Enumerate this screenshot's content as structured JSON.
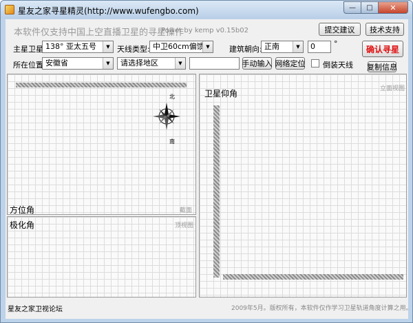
{
  "window": {
    "title": "星友之家寻星精灵(http://www.wufengbo.com)",
    "minimize_glyph": "—",
    "maximize_glyph": "□",
    "close_glyph": "✕"
  },
  "header": {
    "tagline": "本软件仅支持中国上空直播卫星的寻星操作",
    "power": "Power by kemp  v0.15b02",
    "feedback_button": "提交建议",
    "support_button": "技术支持"
  },
  "controls": {
    "satellite_label": "主星卫星:",
    "satellite_value": "138°   亚太五号",
    "antenna_label": "天线类型:",
    "antenna_value": "中卫60cm偏馈",
    "orientation_label": "建筑朝向:",
    "orientation_value": "正南",
    "orientation_degree": "0",
    "degree_symbol": "°",
    "confirm_button": "确认寻星",
    "location_label": "所在位置:",
    "province_value": "安徽省",
    "region_placeholder": "请选择地区",
    "manual_input_value": "",
    "manual_button": "手动输入",
    "network_button": "网络定位",
    "invert_label": "倒装天线",
    "copy_button": "复制信息"
  },
  "panels": {
    "azimuth": {
      "title": "方位角",
      "corner": "截面",
      "compass_north": "北",
      "compass_south": "南"
    },
    "polarization": {
      "title": "极化角",
      "corner": "顶视图"
    },
    "elevation": {
      "title": "卫星仰角",
      "corner": "立面视图"
    }
  },
  "status": {
    "left": "星友之家卫视论坛",
    "right": "2009年5月。版权所有，本软件仅作学习卫星轨道角度计算之用。"
  }
}
